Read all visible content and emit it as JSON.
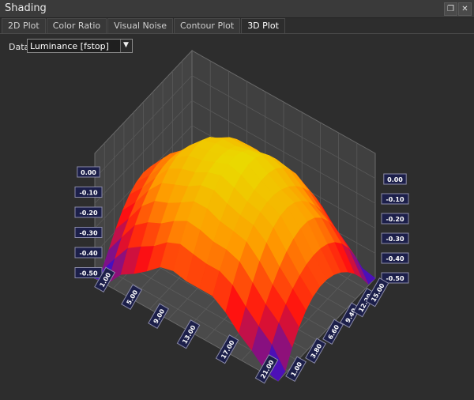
{
  "window": {
    "title": "Shading"
  },
  "tabs": [
    {
      "label": "2D Plot"
    },
    {
      "label": "Color Ratio"
    },
    {
      "label": "Visual Noise"
    },
    {
      "label": "Contour Plot"
    },
    {
      "label": "3D Plot",
      "active": true
    }
  ],
  "data_selector": {
    "label": "Data",
    "value": "Luminance [fstop]"
  },
  "colors": {
    "background": "#2d2d2d",
    "tick_box": "#1c1f4a",
    "tick_border": "#8a8aa8"
  },
  "chart_data": {
    "type": "surface",
    "z_ticks_left": [
      "0.00",
      "-0.10",
      "-0.20",
      "-0.30",
      "-0.40",
      "-0.50"
    ],
    "z_ticks_right": [
      "0.00",
      "-0.10",
      "-0.20",
      "-0.30",
      "-0.40",
      "-0.50"
    ],
    "x_ticks": [
      "1.00",
      "5.00",
      "9.00",
      "13.00",
      "17.00",
      "21.00"
    ],
    "y_ticks": [
      "1.00",
      "3.80",
      "6.60",
      "9.40",
      "12.20",
      "15.00"
    ],
    "zlim": [
      -0.5,
      0.0
    ],
    "colormap": [
      "#2a10d8",
      "#ff1010",
      "#ff9a00",
      "#e8e000"
    ]
  }
}
